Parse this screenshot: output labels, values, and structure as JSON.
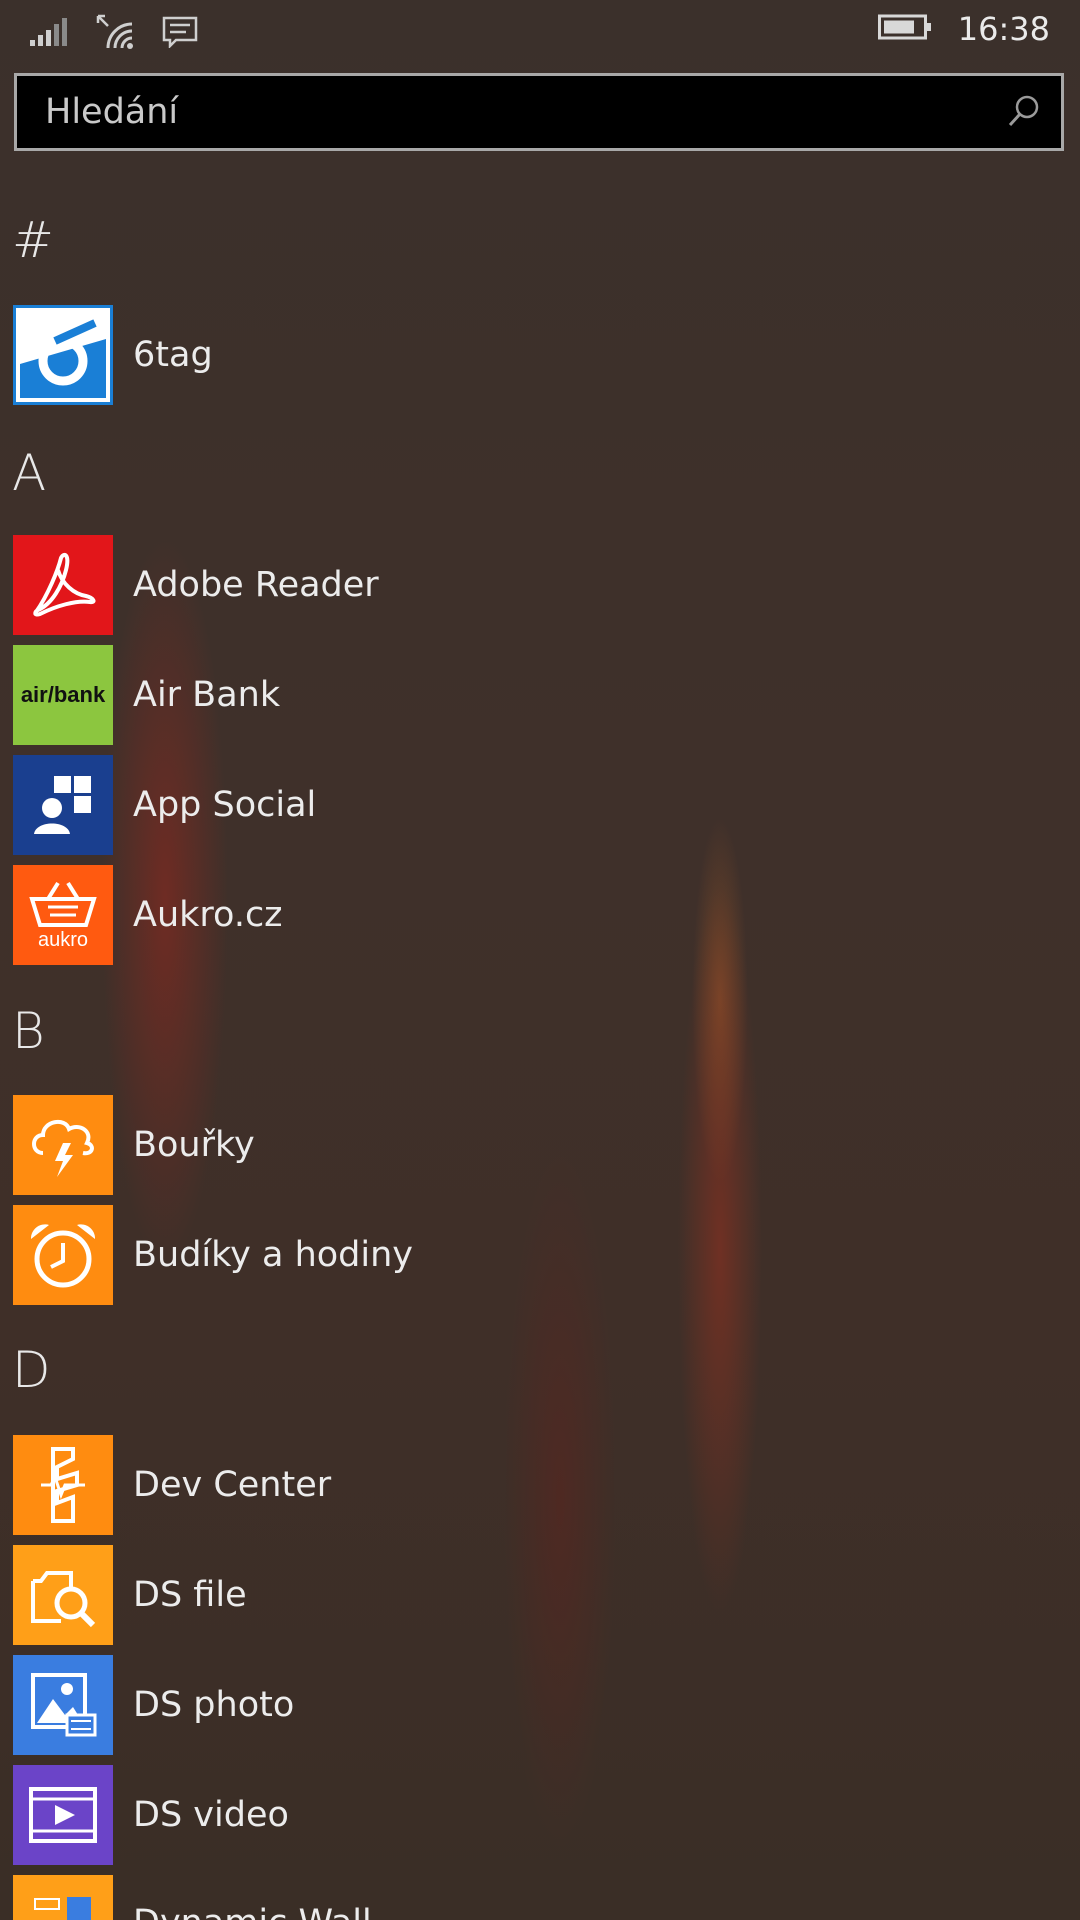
{
  "statusbar": {
    "time": "16:38"
  },
  "search": {
    "placeholder": "Hledání"
  },
  "sections": {
    "hash": {
      "letter": "#"
    },
    "a": {
      "letter": "A"
    },
    "b": {
      "letter": "B"
    },
    "d": {
      "letter": "D"
    }
  },
  "apps": {
    "sixtag": {
      "name": "6tag",
      "color": "#1a7fd6"
    },
    "adobe": {
      "name": "Adobe Reader",
      "color": "#e2161a"
    },
    "airbank": {
      "name": "Air Bank",
      "color": "#8cc63f",
      "logo_text": "air/bank"
    },
    "appsocial": {
      "name": "App Social",
      "color": "#1a3f8f"
    },
    "aukro": {
      "name": "Aukro.cz",
      "color": "#ff5a10",
      "logo_text": "aukro"
    },
    "bourky": {
      "name": "Bouřky",
      "color": "#ff8c10"
    },
    "budiky": {
      "name": "Budíky a hodiny",
      "color": "#ff8c10"
    },
    "devcenter": {
      "name": "Dev Center",
      "color": "#ff8c10"
    },
    "dsfile": {
      "name": "DS file",
      "color": "#ff9f18"
    },
    "dsphoto": {
      "name": "DS photo",
      "color": "#3a7de0"
    },
    "dsvideo": {
      "name": "DS video",
      "color": "#6b44c8"
    },
    "dynamic": {
      "name": "Dynamic Wall",
      "color": "#ff9f18"
    }
  }
}
